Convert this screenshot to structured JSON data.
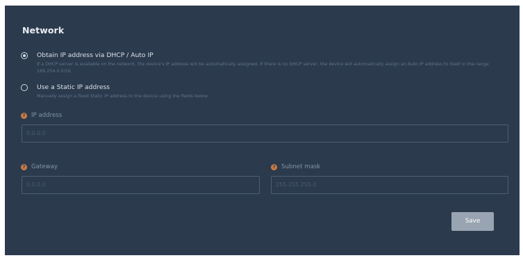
{
  "network": {
    "title": "Network",
    "options": [
      {
        "label": "Obtain IP address via DHCP / Auto IP",
        "description": "If a DHCP server is available on the network, the device's IP address will be automatically assigned. If there is no DHCP server, the device will automatically assign an Auto IP address to itself in the range 169.254.0.0/16",
        "selected": true
      },
      {
        "label": "Use a Static IP address",
        "description": "Manually assign a fixed Static IP address to the device using the fields below.",
        "selected": false
      }
    ],
    "fields": {
      "ip_address": {
        "label": "IP address",
        "placeholder": "0.0.0.0"
      },
      "gateway": {
        "label": "Gateway",
        "placeholder": "0.0.0.0"
      },
      "subnet_mask": {
        "label": "Subnet mask",
        "placeholder": "255.255.255.0"
      }
    },
    "help_icon_glyph": "?",
    "save_label": "Save",
    "colors": {
      "panel_bg": "#2b3a4d",
      "help_icon": "#c97a44",
      "save_button": "#98a4b1"
    }
  }
}
